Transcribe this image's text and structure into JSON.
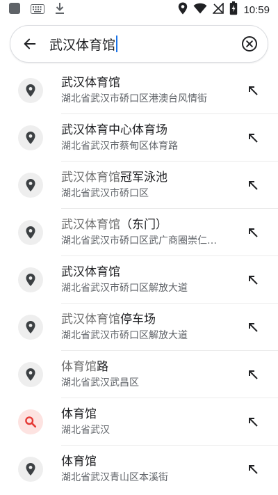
{
  "status_bar": {
    "time": "10:59",
    "left_icons": [
      "app-square-icon",
      "keyboard-icon",
      "download-icon"
    ],
    "right_icons": [
      "location-icon",
      "wifi-icon",
      "no-signal-icon",
      "battery-icon"
    ]
  },
  "search": {
    "query": "武汉体育馆"
  },
  "results": [
    {
      "title": "武汉体育馆",
      "title_prefix": "",
      "subtitle": "湖北省武汉市硚口区港澳台风情街",
      "icon": "place-pin-icon"
    },
    {
      "title": "武汉体育中心体育场",
      "title_prefix": "",
      "subtitle": "湖北省武汉市蔡甸区体育路",
      "icon": "place-pin-icon"
    },
    {
      "title": "冠军泳池",
      "title_prefix": "武汉体育馆",
      "subtitle": "湖北省武汉市硚口区",
      "icon": "place-pin-icon"
    },
    {
      "title": "（东门）",
      "title_prefix": "武汉体育馆",
      "subtitle": "湖北省武汉市硚口区武广商圈崇仁…",
      "icon": "place-pin-icon"
    },
    {
      "title": "武汉体育馆",
      "title_prefix": "",
      "subtitle": "湖北省武汉市硚口区解放大道",
      "icon": "place-pin-icon"
    },
    {
      "title": "停车场",
      "title_prefix": "武汉体育馆",
      "subtitle": "湖北省武汉市硚口区解放大道",
      "icon": "place-pin-icon"
    },
    {
      "title": "路",
      "title_prefix": "体育馆",
      "subtitle": "湖北省武汉武昌区",
      "icon": "place-pin-icon"
    },
    {
      "title": "体育馆",
      "title_prefix": "",
      "subtitle": "湖北省武汉",
      "icon": "search-icon"
    },
    {
      "title": "体育馆",
      "title_prefix": "",
      "subtitle": "湖北省武汉青山区本溪街",
      "icon": "place-pin-icon"
    }
  ],
  "colors": {
    "accent": "#1a73e8",
    "search_icon": "#e53935",
    "pin": "#3c4043"
  }
}
